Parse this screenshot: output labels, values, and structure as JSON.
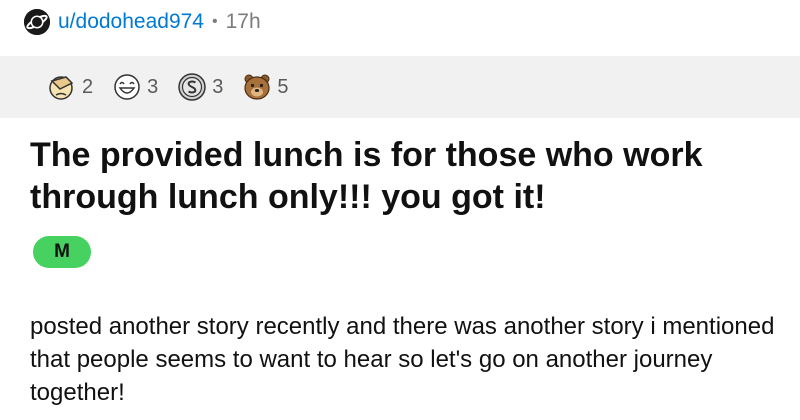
{
  "post": {
    "author": "u/dodohead974",
    "separator": "•",
    "age": "17h",
    "awards": [
      {
        "icon": "facepalm-award-icon",
        "count": "2"
      },
      {
        "icon": "laughing-face-award-icon",
        "count": "3"
      },
      {
        "icon": "silver-coin-award-icon",
        "count": "3"
      },
      {
        "icon": "bear-award-icon",
        "count": "5"
      }
    ],
    "title": "The provided lunch is for those who work through lunch only!!! you got it!",
    "flair": "M",
    "body": "posted another story recently and there was another story i mentioned that people seems to want to hear so let's go on another journey together!"
  },
  "colors": {
    "username": "#0079d3",
    "flair_bg": "#46d160",
    "award_bar_bg": "#f1f1f1"
  }
}
